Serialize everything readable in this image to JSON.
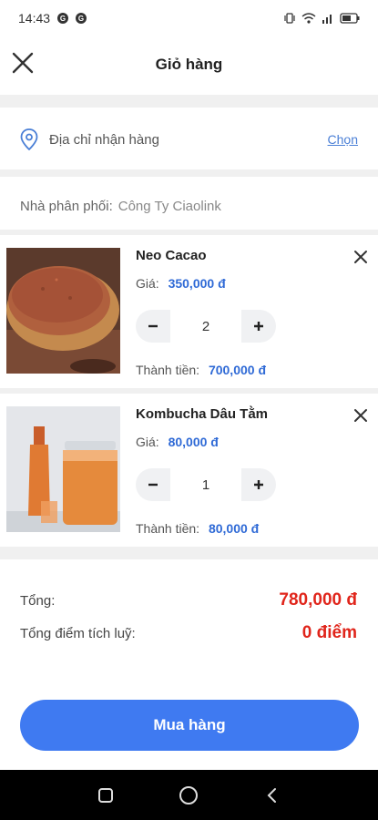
{
  "status_bar": {
    "time": "14:43",
    "notif_icons": [
      "G",
      "G"
    ]
  },
  "header": {
    "title": "Giỏ hàng"
  },
  "address": {
    "placeholder": "Địa chỉ nhận hàng",
    "choose_label": "Chọn"
  },
  "distributor": {
    "label": "Nhà phân phối:",
    "value": "Công Ty Ciaolink"
  },
  "items": [
    {
      "name": "Neo Cacao",
      "price_label": "Giá:",
      "price": "350,000 đ",
      "quantity": "2",
      "total_label": "Thành tiền:",
      "total": "700,000 đ"
    },
    {
      "name": "Kombucha Dâu Tằm",
      "price_label": "Giá:",
      "price": "80,000 đ",
      "quantity": "1",
      "total_label": "Thành tiền:",
      "total": "80,000 đ"
    }
  ],
  "summary": {
    "total_label": "Tổng:",
    "total_value": "780,000 đ",
    "points_label": "Tổng điểm tích luỹ:",
    "points_value": "0 điểm"
  },
  "buy_button": {
    "label": "Mua hàng"
  },
  "colors": {
    "accent": "#3f7af1",
    "price_blue": "#2f6ad6",
    "total_red": "#e0251b"
  },
  "icons": {
    "close": "close-icon",
    "pin": "location-pin-icon",
    "remove": "remove-icon",
    "minus": "minus-icon",
    "plus": "plus-icon",
    "nav_recent": "recent-apps-icon",
    "nav_home": "home-icon",
    "nav_back": "back-icon"
  }
}
